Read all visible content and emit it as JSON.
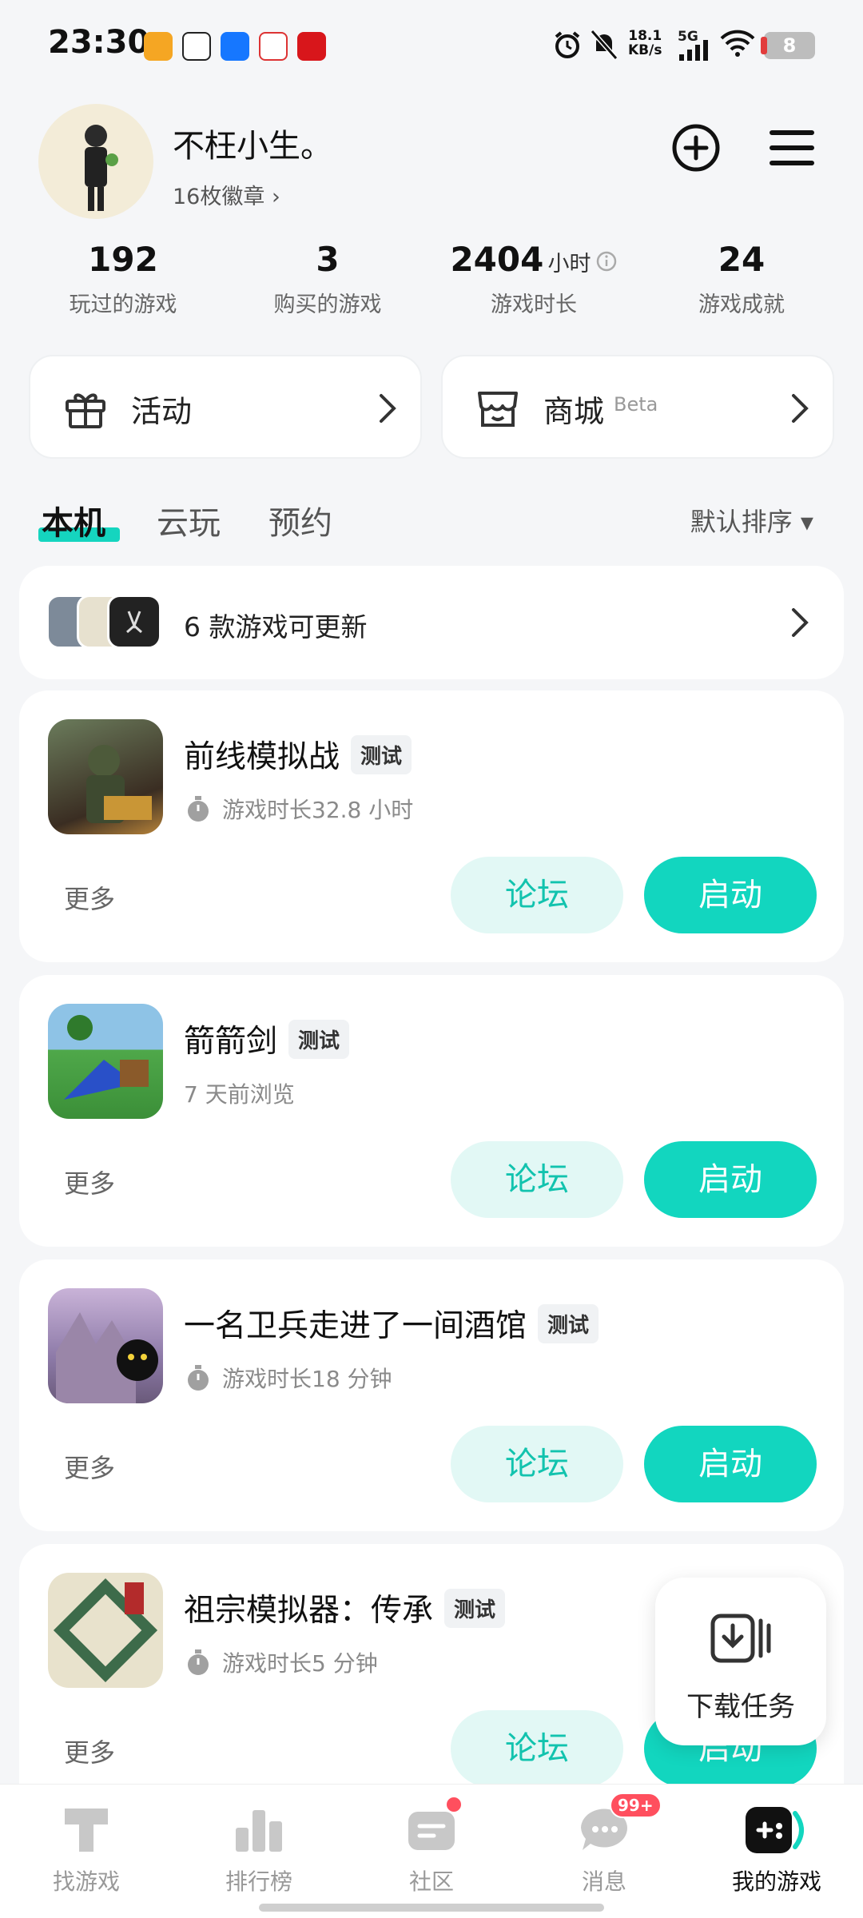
{
  "status_bar": {
    "time": "23:30",
    "net_speed_value": "18.1",
    "net_speed_unit": "KB/s",
    "network": "5G",
    "battery": "8"
  },
  "profile": {
    "username": "不枉小生。",
    "badges": "16枚徽章 ›"
  },
  "stats": [
    {
      "value": "192",
      "unit": "",
      "label": "玩过的游戏"
    },
    {
      "value": "3",
      "unit": "",
      "label": "购买的游戏"
    },
    {
      "value": "2404",
      "unit": "小时",
      "label": "游戏时长"
    },
    {
      "value": "24",
      "unit": "",
      "label": "游戏成就"
    }
  ],
  "quick_cards": {
    "activity": "活动",
    "store": "商城",
    "store_badge": "Beta"
  },
  "tabs": {
    "local": "本机",
    "cloud": "云玩",
    "reserve": "预约",
    "sort": "默认排序 ▾"
  },
  "update_row": {
    "text": "6 款游戏可更新"
  },
  "games": [
    {
      "title": "前线模拟战",
      "tag": "测试",
      "sub": "游戏时长32.8 小时",
      "more": "更多",
      "forum": "论坛",
      "launch": "启动"
    },
    {
      "title": "箭箭剑",
      "tag": "测试",
      "sub": "7 天前浏览",
      "more": "更多",
      "forum": "论坛",
      "launch": "启动"
    },
    {
      "title": "一名卫兵走进了一间酒馆",
      "tag": "测试",
      "sub": "游戏时长18 分钟",
      "more": "更多",
      "forum": "论坛",
      "launch": "启动"
    },
    {
      "title": "祖宗模拟器：传承",
      "tag": "测试",
      "sub": "游戏时长5 分钟",
      "more": "更多",
      "forum": "论坛",
      "launch": "启动"
    }
  ],
  "download_float": {
    "label": "下载任务"
  },
  "bottom_nav": [
    {
      "label": "找游戏"
    },
    {
      "label": "排行榜"
    },
    {
      "label": "社区"
    },
    {
      "label": "消息",
      "badge": "99+"
    },
    {
      "label": "我的游戏"
    }
  ],
  "colors": {
    "accent": "#12d6bf",
    "accent_light": "#e2f8f5",
    "notification": "#ff4f5e"
  }
}
